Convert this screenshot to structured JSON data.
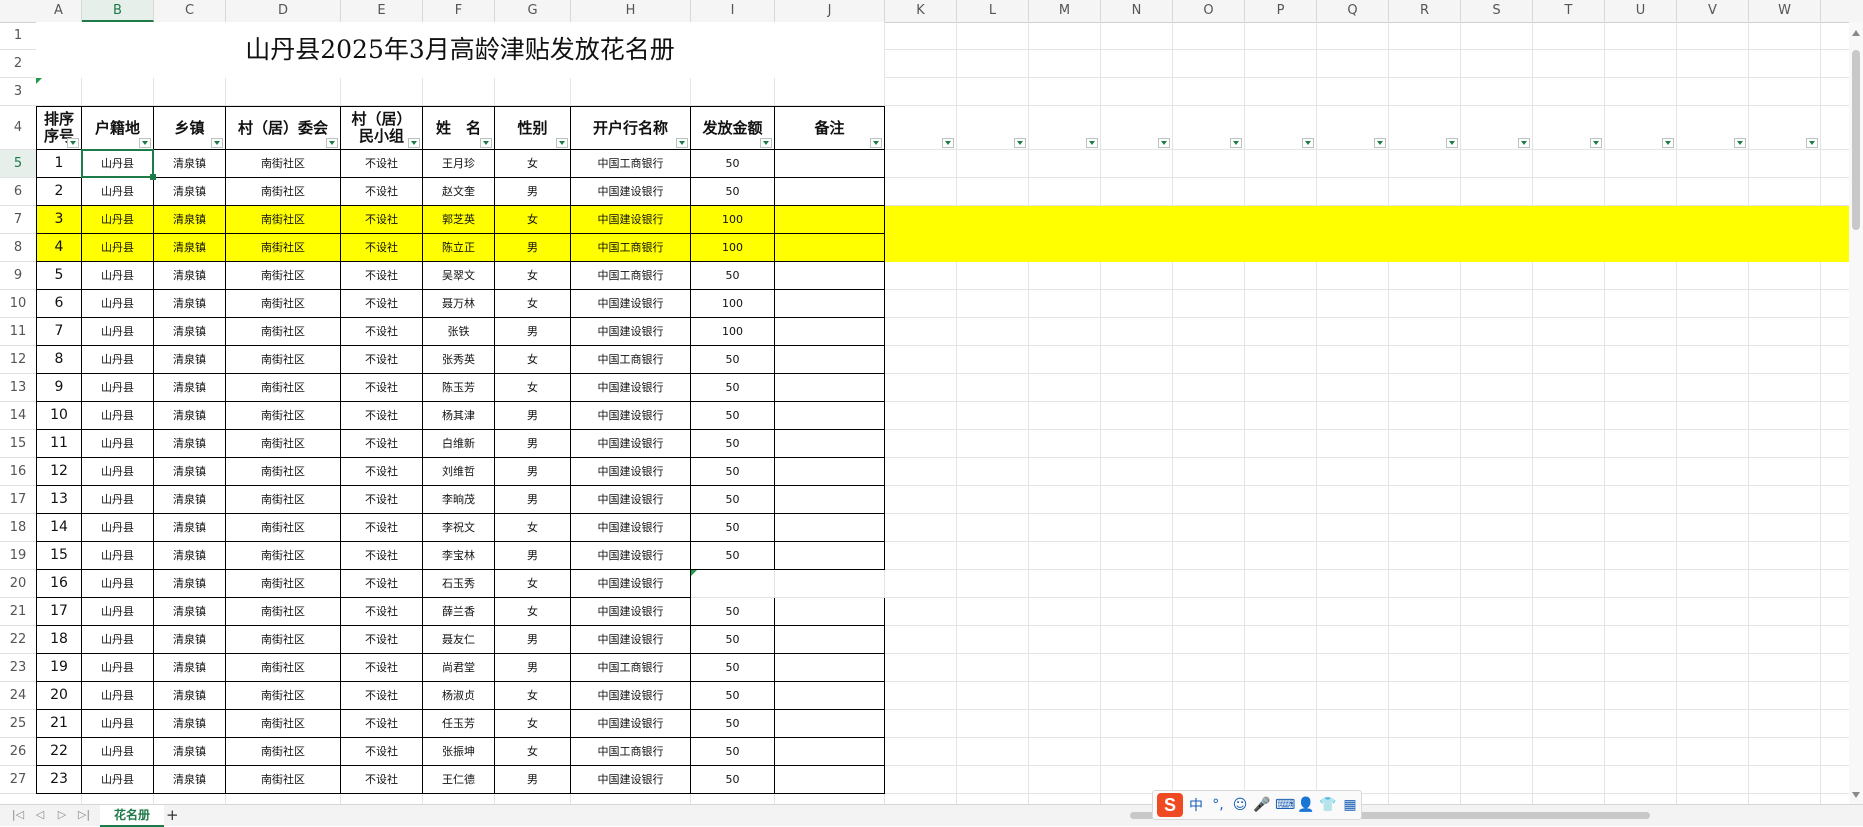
{
  "title": "山丹县2025年3月高龄津贴发放花名册",
  "columns": [
    "A",
    "B",
    "C",
    "D",
    "E",
    "F",
    "G",
    "H",
    "I",
    "J",
    "K",
    "L",
    "M",
    "N",
    "O",
    "P",
    "Q",
    "R",
    "S",
    "T",
    "U",
    "V",
    "W"
  ],
  "active_column": "B",
  "headers": {
    "seq": [
      "排序",
      "序号"
    ],
    "huji": "户籍地",
    "town": "乡镇",
    "village": "村（居）委会",
    "group": [
      "村（居）",
      "民小组"
    ],
    "name": "姓　名",
    "gender": "性别",
    "bank": "开户行名称",
    "amount": "发放金额",
    "note": "备注"
  },
  "rows": [
    {
      "seq": "1",
      "huji": "山丹县",
      "town": "清泉镇",
      "village": "南街社区",
      "group": "不设社",
      "name": "王月珍",
      "gender": "女",
      "bank": "中国工商银行",
      "amount": "50",
      "note": ""
    },
    {
      "seq": "2",
      "huji": "山丹县",
      "town": "清泉镇",
      "village": "南街社区",
      "group": "不设社",
      "name": "赵文奎",
      "gender": "男",
      "bank": "中国建设银行",
      "amount": "50",
      "note": ""
    },
    {
      "seq": "3",
      "huji": "山丹县",
      "town": "清泉镇",
      "village": "南街社区",
      "group": "不设社",
      "name": "郭芝英",
      "gender": "女",
      "bank": "中国建设银行",
      "amount": "100",
      "note": "",
      "highlight": true
    },
    {
      "seq": "4",
      "huji": "山丹县",
      "town": "清泉镇",
      "village": "南街社区",
      "group": "不设社",
      "name": "陈立正",
      "gender": "男",
      "bank": "中国工商银行",
      "amount": "100",
      "note": "",
      "highlight": true
    },
    {
      "seq": "5",
      "huji": "山丹县",
      "town": "清泉镇",
      "village": "南街社区",
      "group": "不设社",
      "name": "吴翠文",
      "gender": "女",
      "bank": "中国工商银行",
      "amount": "50",
      "note": ""
    },
    {
      "seq": "6",
      "huji": "山丹县",
      "town": "清泉镇",
      "village": "南街社区",
      "group": "不设社",
      "name": "聂万林",
      "gender": "女",
      "bank": "中国建设银行",
      "amount": "100",
      "note": ""
    },
    {
      "seq": "7",
      "huji": "山丹县",
      "town": "清泉镇",
      "village": "南街社区",
      "group": "不设社",
      "name": "张铁",
      "gender": "男",
      "bank": "中国建设银行",
      "amount": "100",
      "note": ""
    },
    {
      "seq": "8",
      "huji": "山丹县",
      "town": "清泉镇",
      "village": "南街社区",
      "group": "不设社",
      "name": "张秀英",
      "gender": "女",
      "bank": "中国工商银行",
      "amount": "50",
      "note": ""
    },
    {
      "seq": "9",
      "huji": "山丹县",
      "town": "清泉镇",
      "village": "南街社区",
      "group": "不设社",
      "name": "陈玉芳",
      "gender": "女",
      "bank": "中国建设银行",
      "amount": "50",
      "note": ""
    },
    {
      "seq": "10",
      "huji": "山丹县",
      "town": "清泉镇",
      "village": "南街社区",
      "group": "不设社",
      "name": "杨其津",
      "gender": "男",
      "bank": "中国建设银行",
      "amount": "50",
      "note": ""
    },
    {
      "seq": "11",
      "huji": "山丹县",
      "town": "清泉镇",
      "village": "南街社区",
      "group": "不设社",
      "name": "白维新",
      "gender": "男",
      "bank": "中国建设银行",
      "amount": "50",
      "note": ""
    },
    {
      "seq": "12",
      "huji": "山丹县",
      "town": "清泉镇",
      "village": "南街社区",
      "group": "不设社",
      "name": "刘维哲",
      "gender": "男",
      "bank": "中国建设银行",
      "amount": "50",
      "note": ""
    },
    {
      "seq": "13",
      "huji": "山丹县",
      "town": "清泉镇",
      "village": "南街社区",
      "group": "不设社",
      "name": "李晌茂",
      "gender": "男",
      "bank": "中国建设银行",
      "amount": "50",
      "note": ""
    },
    {
      "seq": "14",
      "huji": "山丹县",
      "town": "清泉镇",
      "village": "南街社区",
      "group": "不设社",
      "name": "李祝文",
      "gender": "女",
      "bank": "中国建设银行",
      "amount": "50",
      "note": ""
    },
    {
      "seq": "15",
      "huji": "山丹县",
      "town": "清泉镇",
      "village": "南街社区",
      "group": "不设社",
      "name": "李宝林",
      "gender": "男",
      "bank": "中国建设银行",
      "amount": "50",
      "note": ""
    },
    {
      "seq": "16",
      "huji": "山丹县",
      "town": "清泉镇",
      "village": "南街社区",
      "group": "不设社",
      "name": "石玉秀",
      "gender": "女",
      "bank": "中国建设银行",
      "amount": "",
      "note": "",
      "noborder_tail": true
    },
    {
      "seq": "17",
      "huji": "山丹县",
      "town": "清泉镇",
      "village": "南街社区",
      "group": "不设社",
      "name": "薛兰香",
      "gender": "女",
      "bank": "中国建设银行",
      "amount": "50",
      "note": ""
    },
    {
      "seq": "18",
      "huji": "山丹县",
      "town": "清泉镇",
      "village": "南街社区",
      "group": "不设社",
      "name": "聂友仁",
      "gender": "男",
      "bank": "中国建设银行",
      "amount": "50",
      "note": ""
    },
    {
      "seq": "19",
      "huji": "山丹县",
      "town": "清泉镇",
      "village": "南街社区",
      "group": "不设社",
      "name": "尚君堂",
      "gender": "男",
      "bank": "中国工商银行",
      "amount": "50",
      "note": ""
    },
    {
      "seq": "20",
      "huji": "山丹县",
      "town": "清泉镇",
      "village": "南街社区",
      "group": "不设社",
      "name": "杨淑贞",
      "gender": "女",
      "bank": "中国建设银行",
      "amount": "50",
      "note": ""
    },
    {
      "seq": "21",
      "huji": "山丹县",
      "town": "清泉镇",
      "village": "南街社区",
      "group": "不设社",
      "name": "任玉芳",
      "gender": "女",
      "bank": "中国建设银行",
      "amount": "50",
      "note": ""
    },
    {
      "seq": "22",
      "huji": "山丹县",
      "town": "清泉镇",
      "village": "南街社区",
      "group": "不设社",
      "name": "张振坤",
      "gender": "女",
      "bank": "中国工商银行",
      "amount": "50",
      "note": ""
    },
    {
      "seq": "23",
      "huji": "山丹县",
      "town": "清泉镇",
      "village": "南街社区",
      "group": "不设社",
      "name": "王仁德",
      "gender": "男",
      "bank": "中国建设银行",
      "amount": "50",
      "note": ""
    }
  ],
  "row_numbers": [
    "1",
    "2",
    "3",
    "4",
    "5",
    "6",
    "7",
    "8",
    "9",
    "10",
    "11",
    "12",
    "13",
    "14",
    "15",
    "16",
    "17",
    "18",
    "19",
    "20",
    "21",
    "22",
    "23",
    "24",
    "25",
    "26",
    "27"
  ],
  "active_row": "5",
  "sheet_tab": "花名册",
  "add_tab_label": "+",
  "nav_buttons": [
    "|◁",
    "◁",
    "▷",
    "▷|"
  ],
  "ime": {
    "logo": "S",
    "items": [
      "中",
      "°,",
      "☺",
      "🎤",
      "⌨",
      "👤",
      "👕",
      "▦"
    ]
  },
  "colors": {
    "accent": "#1f7a4a",
    "highlight": "#ffff00"
  }
}
